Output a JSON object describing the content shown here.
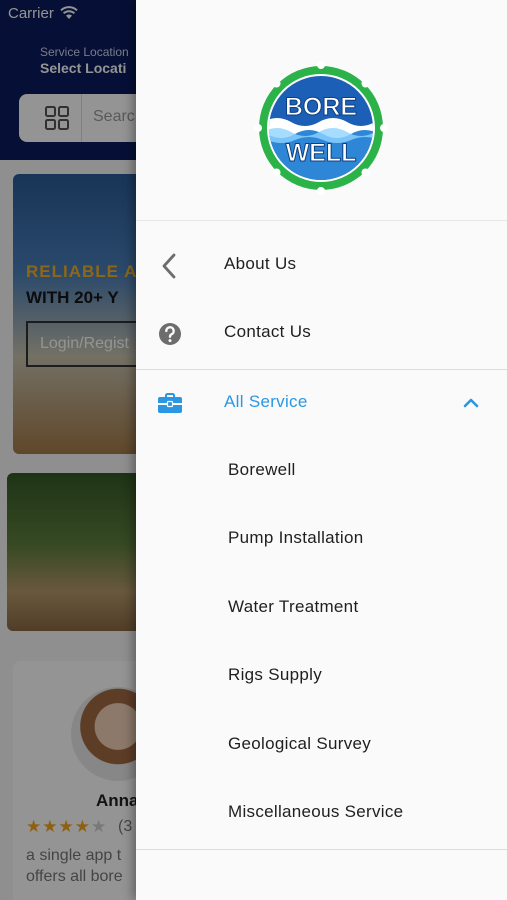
{
  "status_bar": {
    "carrier": "Carrier"
  },
  "background": {
    "service_location_label": "Service Location",
    "service_location_value": "Select Locati",
    "search_placeholder": "Searc",
    "banner": {
      "line1": "RELIABLE A",
      "line2": "WITH 20+ Y",
      "login_label": "Login/Regist"
    },
    "review": {
      "name": "Anna",
      "stars": "★★★★",
      "stars_off": "★",
      "count": "(3",
      "text": "a single app t offers all bore"
    }
  },
  "drawer": {
    "logo": {
      "line1": "BORE",
      "line2": "WELL"
    },
    "menu": [
      {
        "label": "About Us",
        "icon": "chevron-left-icon"
      },
      {
        "label": "Contact Us",
        "icon": "help-circle-icon"
      },
      {
        "label": "All Service",
        "icon": "briefcase-icon",
        "expanded": true
      }
    ],
    "services": [
      "Borewell",
      "Pump Installation",
      "Water Treatment",
      "Rigs Supply",
      "Geological Survey",
      "Miscellaneous Service"
    ]
  },
  "colors": {
    "header_navy": "#0c1a5e",
    "accent_blue": "#2b97e2",
    "logo_green": "#2bb34a",
    "logo_blue": "#1b5fb7"
  }
}
